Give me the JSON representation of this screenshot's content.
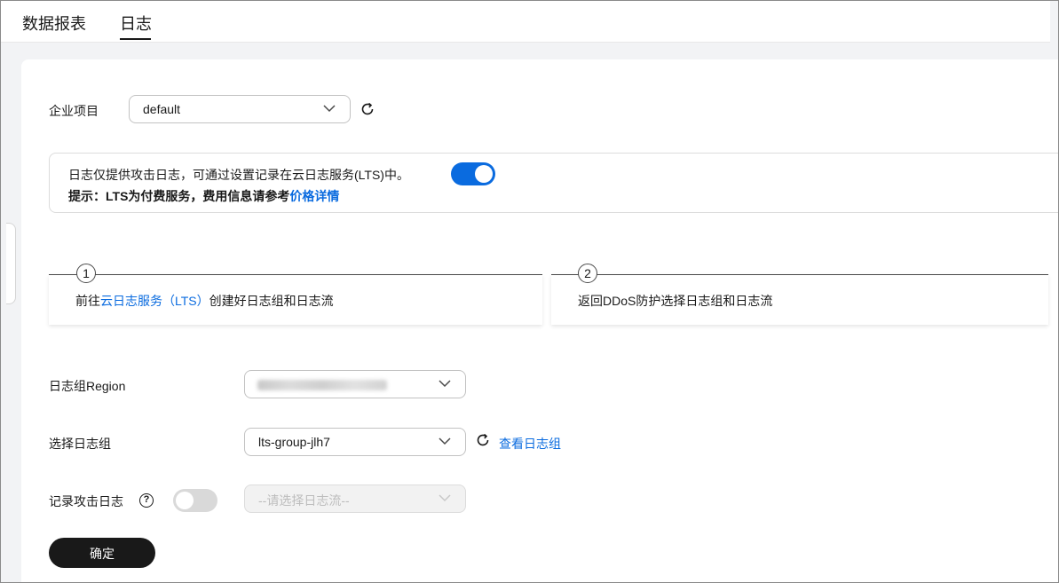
{
  "tabs": [
    {
      "label": "数据报表",
      "active": false
    },
    {
      "label": "日志",
      "active": true
    }
  ],
  "enterprise_project": {
    "label": "企业项目",
    "value": "default"
  },
  "notice": {
    "text": "日志仅提供攻击日志，可通过设置记录在云日志服务(LTS)中。",
    "toggle_on": true,
    "tip_prefix": "提示：LTS为付费服务，费用信息请参考",
    "tip_link": "价格详情"
  },
  "steps": [
    {
      "number": "1",
      "text_before": "前往",
      "link": "云日志服务（LTS）",
      "text_after": "创建好日志组和日志流"
    },
    {
      "number": "2",
      "text": "返回DDoS防护选择日志组和日志流"
    }
  ],
  "form": {
    "region": {
      "label": "日志组Region"
    },
    "log_group": {
      "label": "选择日志组",
      "value": "lts-group-jlh7",
      "link": "查看日志组"
    },
    "attack_log": {
      "label": "记录攻击日志",
      "toggle_on": false,
      "placeholder": "--请选择日志流--"
    }
  },
  "confirm_button": "确定",
  "colors": {
    "accent": "#0a6bdf",
    "primary_button": "#191919",
    "page_bg": "#f2f3f5"
  }
}
